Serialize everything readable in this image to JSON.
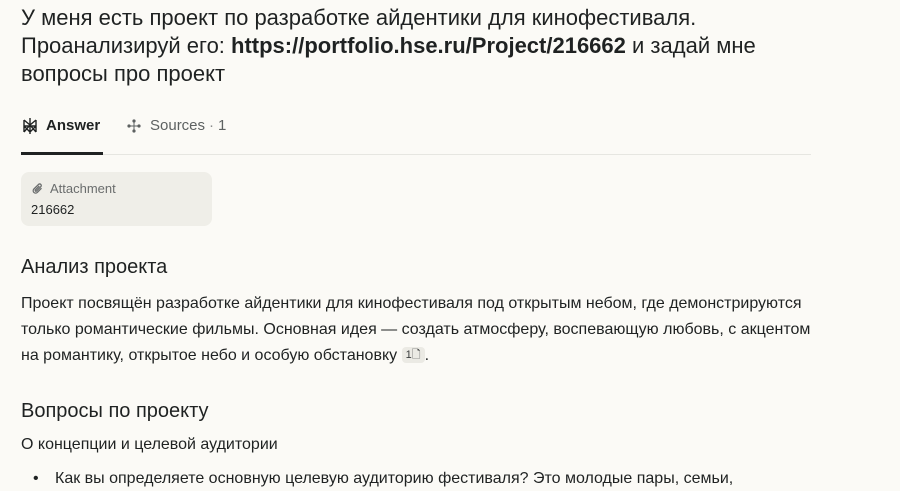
{
  "query": {
    "text_before": "У меня есть проект по разработке айдентики для кинофестиваля. Проанализируй его: ",
    "link": "https://portfolio.hse.ru/Project/216662",
    "text_after": " и задай мне вопросы про проект"
  },
  "tabs": {
    "answer_label": "Answer",
    "sources_label": "Sources",
    "sources_count": "1"
  },
  "attachment": {
    "label": "Attachment",
    "name": "216662"
  },
  "section1": {
    "heading": "Анализ проекта",
    "text": "Проект посвящён разработке айдентики для кинофестиваля под открытым небом, где демонстрируются только романтические фильмы. Основная идея — создать атмосферу, воспевающую любовь, с акцентом на романтику, открытое небо и особую обстановку",
    "citation": "1",
    "end": "."
  },
  "section2": {
    "heading": "Вопросы по проекту",
    "subheading": "О концепции и целевой аудитории",
    "bullet1": "Как вы определяете основную целевую аудиторию фестиваля? Это молодые пары, семьи,"
  },
  "colors": {
    "background": "#fbfaf6",
    "text": "#1f2222",
    "attachment_bg": "#efeee8"
  },
  "icons": {
    "answer": "perplexity-logo-icon",
    "sources": "sources-icon",
    "attachment": "paperclip-icon",
    "citation": "document-icon"
  }
}
